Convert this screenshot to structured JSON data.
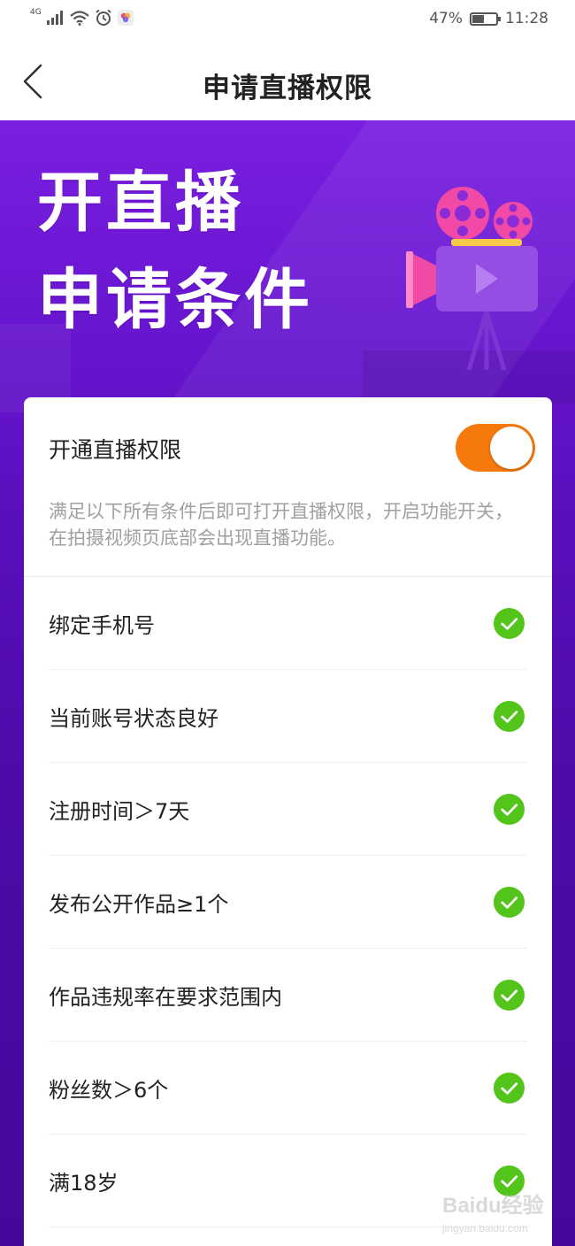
{
  "status_bar": {
    "network_type": "4G",
    "battery_percent": "47%",
    "battery_level": 0.47,
    "time": "11:28",
    "icons": [
      "signal-icon",
      "wifi-icon",
      "alarm-icon",
      "app-notification-icon"
    ]
  },
  "nav": {
    "back_icon": "chevron-left-icon",
    "title": "申请直播权限"
  },
  "banner": {
    "headline_line1": "开直播",
    "headline_line2": "申请条件",
    "illustration": "movie-camera-icon"
  },
  "permission": {
    "toggle_label": "开通直播权限",
    "toggle_on": true,
    "toggle_color": "#f5790b",
    "description": "满足以下所有条件后即可打开直播权限，开启功能开关，在拍摄视频页底部会出现直播功能。"
  },
  "conditions": [
    {
      "label": "绑定手机号",
      "met": true
    },
    {
      "label": "当前账号状态良好",
      "met": true
    },
    {
      "label": "注册时间＞7天",
      "met": true
    },
    {
      "label": "发布公开作品≥1个",
      "met": true
    },
    {
      "label": "作品违规率在要求范围内",
      "met": true
    },
    {
      "label": "粉丝数＞6个",
      "met": true
    },
    {
      "label": "满18岁",
      "met": true
    }
  ],
  "colors": {
    "check_green": "#52c41a",
    "banner_purple": "#6816d0",
    "accent_orange": "#f5790b"
  },
  "watermark": {
    "brand": "Baidu经验",
    "url": "jingyan.baidu.com"
  }
}
